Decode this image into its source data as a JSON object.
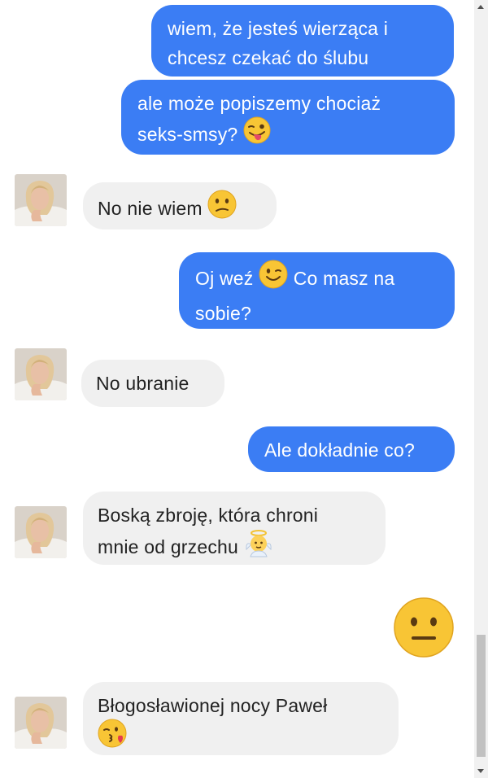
{
  "messages": [
    {
      "from": "me",
      "lines": [
        "wiem, że jesteś wierząca i",
        "chcesz czekać do ślubu"
      ]
    },
    {
      "from": "me",
      "lines": [
        "ale może popiszemy chociaż",
        "seks-smsy?"
      ],
      "emoji": "winking-face-with-tongue"
    },
    {
      "from": "them",
      "lines": [
        "No nie wiem"
      ],
      "emoji": "confused-face"
    },
    {
      "from": "me",
      "lines": [
        "Oj weź",
        "Co masz na",
        "sobie?"
      ],
      "emoji": "winking-face"
    },
    {
      "from": "them",
      "lines": [
        "No ubranie"
      ]
    },
    {
      "from": "me",
      "lines": [
        "Ale dokładnie co?"
      ]
    },
    {
      "from": "them",
      "lines": [
        "Boską zbroję, która chroni",
        "mnie od grzechu"
      ],
      "emoji": "baby-angel"
    },
    {
      "from": "me",
      "emoji_only": "neutral-face"
    },
    {
      "from": "them",
      "lines": [
        "Błogosławionej nocy Paweł"
      ],
      "emoji": "face-blowing-a-kiss"
    }
  ],
  "colors": {
    "outgoing_bubble": "#3b7df4",
    "incoming_bubble": "#f0f0f0",
    "outgoing_text": "#ffffff",
    "incoming_text": "#222222"
  }
}
